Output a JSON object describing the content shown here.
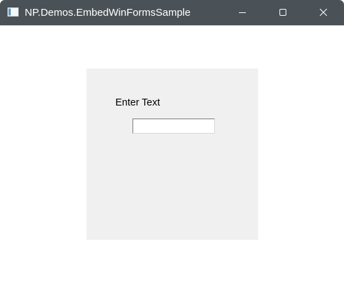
{
  "window": {
    "title": "NP.Demos.EmbedWinFormsSample",
    "app_icon": "window-app-icon",
    "controls": {
      "minimize_icon": "minimize-icon",
      "maximize_icon": "maximize-icon",
      "close_icon": "close-icon"
    }
  },
  "form": {
    "label": "Enter Text",
    "input_value": ""
  }
}
